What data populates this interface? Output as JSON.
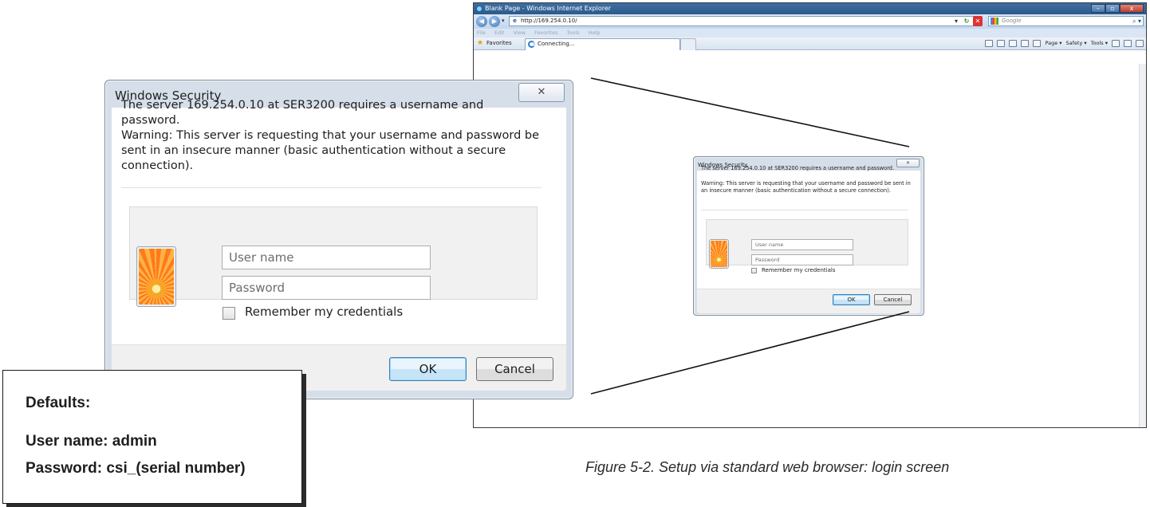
{
  "browser": {
    "window_title": "Blank Page - Windows Internet Explorer",
    "address": "http://169.254.0.10/",
    "search_placeholder": "Google",
    "menu": [
      "File",
      "Edit",
      "View",
      "Favorites",
      "Tools",
      "Help"
    ],
    "favorites_label": "Favorites",
    "tab_title": "Connecting...",
    "command_bar": [
      "Page ▾",
      "Safety ▾",
      "Tools ▾"
    ]
  },
  "dialog": {
    "title": "Windows Security",
    "message": "The server 169.254.0.10 at SER3200 requires a username and password.",
    "warning": "Warning: This server is requesting that your username and password be sent in an insecure manner (basic authentication without a secure connection).",
    "username_placeholder": "User name",
    "password_placeholder": "Password",
    "remember_label": "Remember my credentials",
    "ok_label": "OK",
    "cancel_label": "Cancel"
  },
  "defaults": {
    "title": "Defaults:",
    "username_line": "User name: admin",
    "password_line": "Password: csi_(serial number)"
  },
  "caption": "Figure 5-2. Setup via standard web browser: login screen",
  "colors": {
    "titlebar": "#2b5a8c",
    "ok_button_border": "#3c7fb1",
    "dialog_frame": "#d6dfe9"
  }
}
